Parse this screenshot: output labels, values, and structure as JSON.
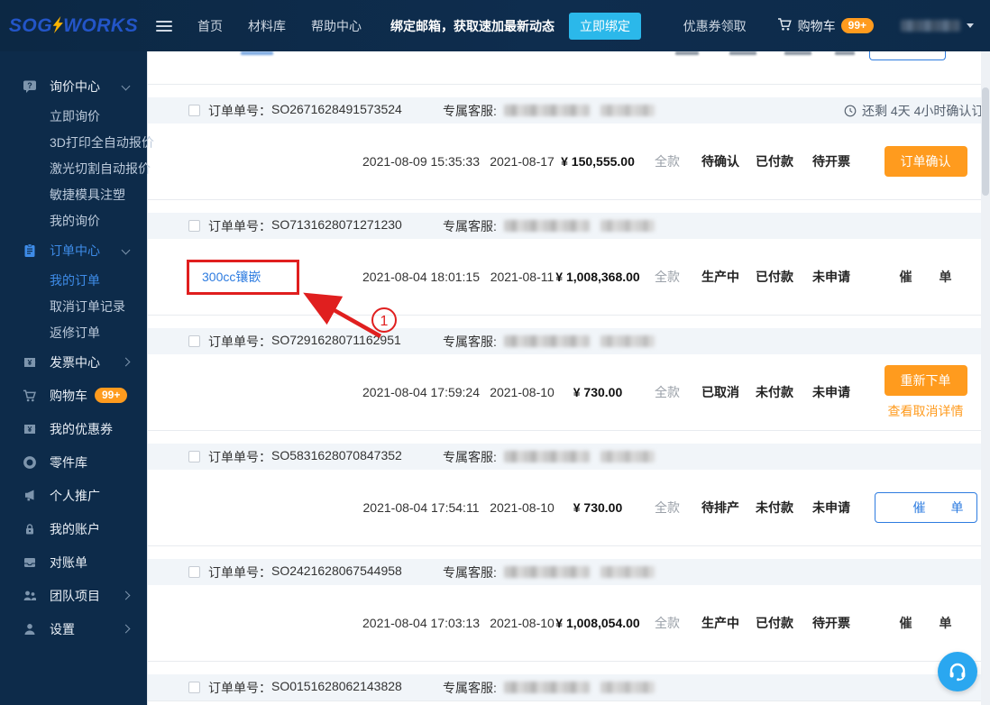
{
  "navbar": {
    "logo_part1": "SOG",
    "logo_part2": "WORKS",
    "menu": [
      {
        "label": "首页"
      },
      {
        "label": "材料库"
      },
      {
        "label": "帮助中心"
      }
    ],
    "bind_notice": "绑定邮箱，获取速加最新动态",
    "bind_button": "立即绑定",
    "coupon_link": "优惠券领取",
    "cart_label": "购物车",
    "cart_badge": "99+"
  },
  "sidebar": {
    "items": [
      {
        "label": "询价中心"
      },
      {
        "label": "立即询价"
      },
      {
        "label": "3D打印全自动报价"
      },
      {
        "label": "激光切割自动报价"
      },
      {
        "label": "敏捷模具注塑"
      },
      {
        "label": "我的询价"
      },
      {
        "label": "订单中心"
      },
      {
        "label": "我的订单"
      },
      {
        "label": "取消订单记录"
      },
      {
        "label": "返修订单"
      },
      {
        "label": "发票中心"
      },
      {
        "label": "购物车",
        "badge": "99+"
      },
      {
        "label": "我的优惠券"
      },
      {
        "label": "零件库"
      },
      {
        "label": "个人推广"
      },
      {
        "label": "我的账户"
      },
      {
        "label": "对账单"
      },
      {
        "label": "团队项目"
      },
      {
        "label": "设置"
      }
    ]
  },
  "orders": {
    "order_no_label": "订单单号：",
    "cs_label": "专属客服:",
    "list": [
      {
        "number": "SO2671628491573524",
        "countdown": "还剩 4天 4小时确认订",
        "datetime": "2021-08-09 15:35:33",
        "due_date": "2021-08-17",
        "amount": "¥ 150,555.00",
        "pay_type": "全款",
        "order_status": "待确认",
        "pay_status": "已付款",
        "invoice_status": "待开票",
        "action_button": "订单确认"
      },
      {
        "number": "SO7131628071271230",
        "product": "300cc镶嵌",
        "datetime": "2021-08-04 18:01:15",
        "due_date": "2021-08-11",
        "amount": "¥ 1,008,368.00",
        "pay_type": "全款",
        "order_status": "生产中",
        "pay_status": "已付款",
        "invoice_status": "未申请",
        "urge_label": "催单"
      },
      {
        "number": "SO7291628071162951",
        "datetime": "2021-08-04 17:59:24",
        "due_date": "2021-08-10",
        "amount": "¥ 730.00",
        "pay_type": "全款",
        "order_status": "已取消",
        "pay_status": "未付款",
        "invoice_status": "未申请",
        "action_button": "重新下单",
        "action_link": "查看取消详情"
      },
      {
        "number": "SO5831628070847352",
        "datetime": "2021-08-04 17:54:11",
        "due_date": "2021-08-10",
        "amount": "¥ 730.00",
        "pay_type": "全款",
        "order_status": "待排产",
        "pay_status": "未付款",
        "invoice_status": "未申请",
        "urge_button": "催单"
      },
      {
        "number": "SO2421628067544958",
        "datetime": "2021-08-04 17:03:13",
        "due_date": "2021-08-10",
        "amount": "¥ 1,008,054.00",
        "pay_type": "全款",
        "order_status": "生产中",
        "pay_status": "已付款",
        "invoice_status": "待开票",
        "urge_label": "催单"
      },
      {
        "number": "SO0151628062143828"
      }
    ]
  },
  "annotation": {
    "step_number": "1"
  },
  "colors": {
    "navy": "#0d2b4a",
    "accent_orange": "#ff9b1e",
    "accent_blue": "#2e7ce0",
    "bind_cyan": "#2bb8ea",
    "annotation_red": "#e01f1f"
  }
}
